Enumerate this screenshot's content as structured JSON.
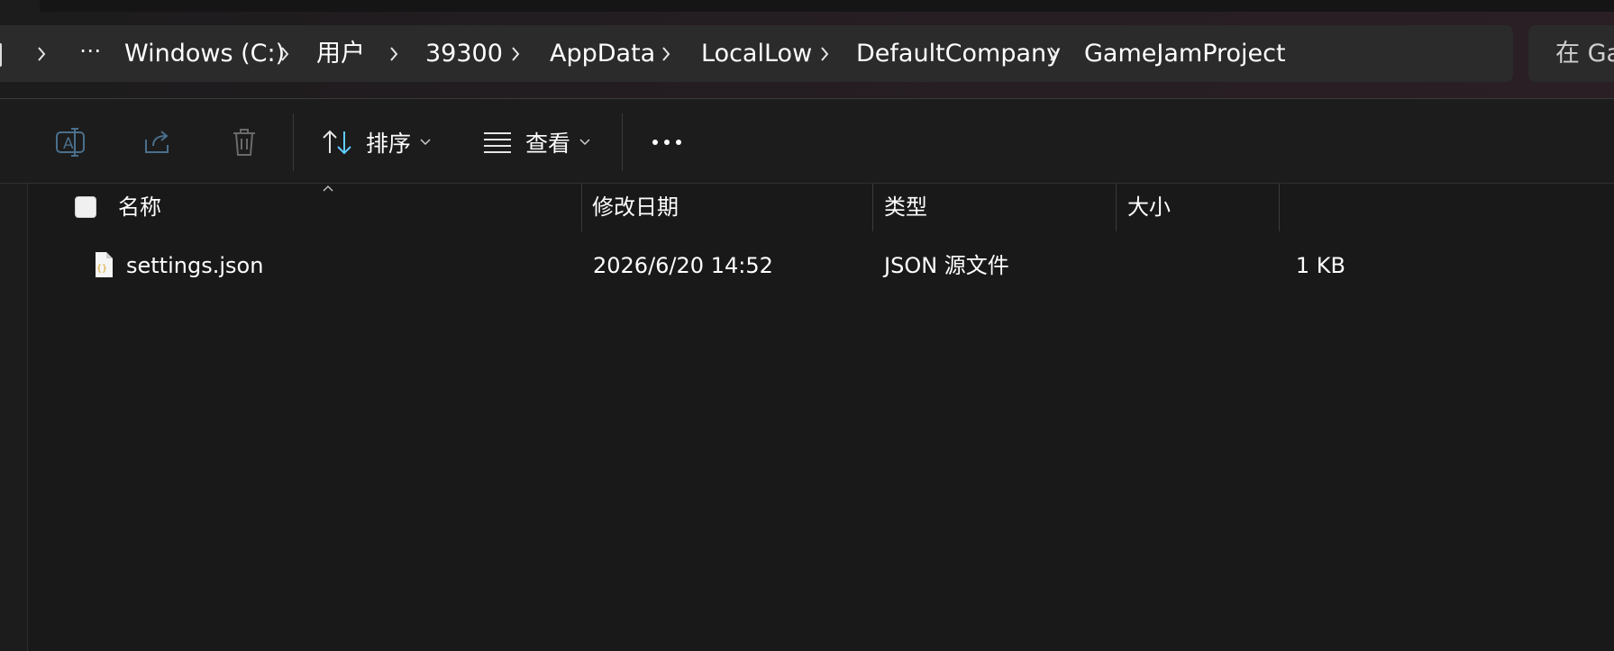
{
  "address_bar": {
    "ellipsis": "⋯",
    "crumbs": [
      "Windows (C:)",
      "用户",
      "39300",
      "AppData",
      "LocalLow",
      "DefaultCompany",
      "GameJamProject"
    ]
  },
  "search": {
    "placeholder": "在 Ga"
  },
  "toolbar": {
    "sort_label": "排序",
    "view_label": "查看"
  },
  "columns": {
    "name": "名称",
    "modified": "修改日期",
    "type": "类型",
    "size": "大小"
  },
  "files": [
    {
      "name": "settings.json",
      "modified": "2026/6/20 14:52",
      "type": "JSON 源文件",
      "size": "1 KB",
      "icon": "json-file-icon"
    }
  ],
  "colors": {
    "background": "#191919",
    "address_bar": "#2b2b2b",
    "accent_icon": "#60cdff",
    "json_icon": "#d4a017"
  }
}
